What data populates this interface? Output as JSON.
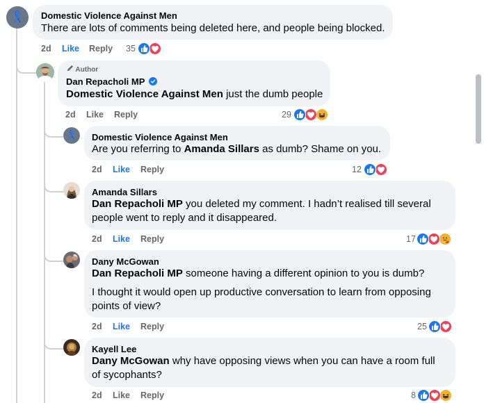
{
  "comments": [
    {
      "author": "Domestic Violence Against Men",
      "text": "There are lots of comments being deleted here, and people being blocked.",
      "time": "2d",
      "like": "Like",
      "reply": "Reply",
      "count": "35",
      "reactions": [
        "like-reaction-icon",
        "love-reaction-icon"
      ]
    },
    {
      "badge": "Author",
      "author": "Dan Repacholi MP",
      "verified": true,
      "mention": "Domestic Violence Against Men",
      "text": " just the dumb people",
      "time": "2d",
      "like": "Like",
      "reply": "Reply",
      "count": "29",
      "reactions": [
        "like-reaction-icon",
        "love-reaction-icon",
        "haha-reaction-icon"
      ]
    },
    {
      "author": "Domestic Violence Against Men",
      "text_pre": "Are you referring to ",
      "mention": "Amanda Sillars",
      "text": " as dumb? Shame on you.",
      "time": "2d",
      "like": "Like",
      "reply": "Reply",
      "count": "12",
      "reactions": [
        "like-reaction-icon",
        "love-reaction-icon"
      ]
    },
    {
      "author": "Amanda Sillars",
      "mention": "Dan Repacholi MP",
      "text": " you deleted my comment. I hadn’t realised till several people went to reply and it disappeared.",
      "time": "2d",
      "like": "Like",
      "reply": "Reply",
      "count": "17",
      "reactions": [
        "like-reaction-icon",
        "love-reaction-icon",
        "care-reaction-icon"
      ]
    },
    {
      "author": "Dany McGowan",
      "mention": "Dan Repacholi MP",
      "text": " someone having a different opinion to you is dumb?",
      "text2": "I thought it would open up productive conversation to learn from opposing points of view?",
      "time": "2d",
      "like": "Like",
      "reply": "Reply",
      "count": "25",
      "reactions": [
        "like-reaction-icon",
        "love-reaction-icon"
      ]
    },
    {
      "author": "Kayell Lee",
      "mention": "Dany McGowan",
      "text": " why have opposing views when you can have a room full of sycophants?",
      "time": "2d",
      "like": "Like",
      "reply": "Reply",
      "count": "8",
      "reactions": [
        "like-reaction-icon",
        "love-reaction-icon",
        "haha-reaction-icon"
      ]
    }
  ],
  "colors": {
    "bubble": "#f0f2f5",
    "like_blue": "#1877f2",
    "meta_gray": "#65676b",
    "love_red": "#f33e58",
    "haha_yellow": "#f7b125"
  }
}
